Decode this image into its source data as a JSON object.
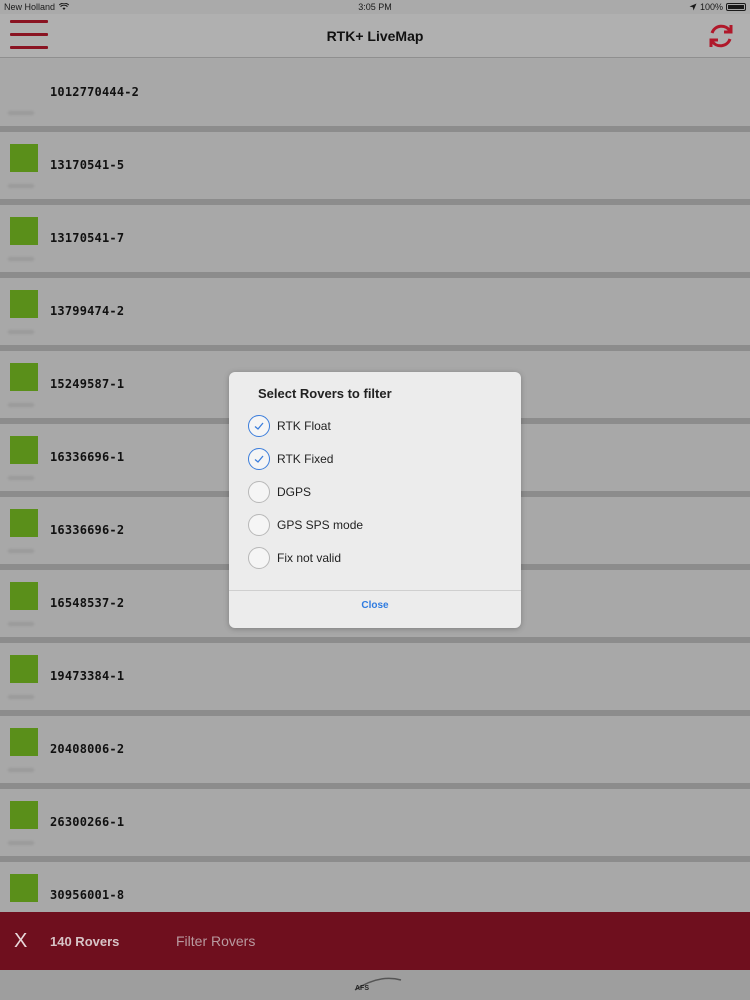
{
  "status_bar": {
    "carrier": "New Holland",
    "time": "3:05 PM",
    "battery": "100%"
  },
  "nav": {
    "title": "RTK+ LiveMap"
  },
  "rovers": [
    {
      "id": "1012770444-2",
      "has_indicator": false
    },
    {
      "id": "13170541-5",
      "has_indicator": true
    },
    {
      "id": "13170541-7",
      "has_indicator": true
    },
    {
      "id": "13799474-2",
      "has_indicator": true
    },
    {
      "id": "15249587-1",
      "has_indicator": true
    },
    {
      "id": "16336696-1",
      "has_indicator": true
    },
    {
      "id": "16336696-2",
      "has_indicator": true
    },
    {
      "id": "16548537-2",
      "has_indicator": true
    },
    {
      "id": "19473384-1",
      "has_indicator": true
    },
    {
      "id": "20408006-2",
      "has_indicator": true
    },
    {
      "id": "26300266-1",
      "has_indicator": true
    },
    {
      "id": "30956001-8",
      "has_indicator": true
    }
  ],
  "bottom_bar": {
    "close_label": "X",
    "rover_count": "140 Rovers",
    "filter_label": "Filter Rovers"
  },
  "footer": {
    "logo_text": "AFS"
  },
  "modal": {
    "title": "Select Rovers to filter",
    "options": [
      {
        "label": "RTK Float",
        "checked": true
      },
      {
        "label": "RTK Fixed",
        "checked": true
      },
      {
        "label": "DGPS",
        "checked": false
      },
      {
        "label": "GPS SPS mode",
        "checked": false
      },
      {
        "label": "Fix not valid",
        "checked": false
      }
    ],
    "close_label": "Close"
  },
  "colors": {
    "accent": "#8a1322",
    "rover_green": "#5a8f1a",
    "check_blue": "#3b7ddb"
  }
}
